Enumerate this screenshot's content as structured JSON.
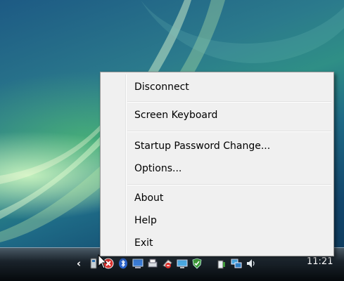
{
  "context_menu": {
    "items": [
      {
        "label": "Disconnect"
      },
      {
        "label": "Screen Keyboard"
      },
      {
        "label": "Startup Password Change..."
      },
      {
        "label": "Options..."
      },
      {
        "label": "About"
      },
      {
        "label": "Help"
      },
      {
        "label": "Exit"
      }
    ]
  },
  "taskbar": {
    "tray_icons": [
      "show-hidden-icons-chevron",
      "usb-device-icon",
      "security-alert-icon",
      "bluetooth-icon",
      "network-monitor-icon",
      "printer-icon",
      "eraser-icon",
      "display-icon",
      "shield-check-icon",
      "power-icon",
      "network-icon",
      "volume-icon"
    ],
    "clock": "11:21"
  }
}
